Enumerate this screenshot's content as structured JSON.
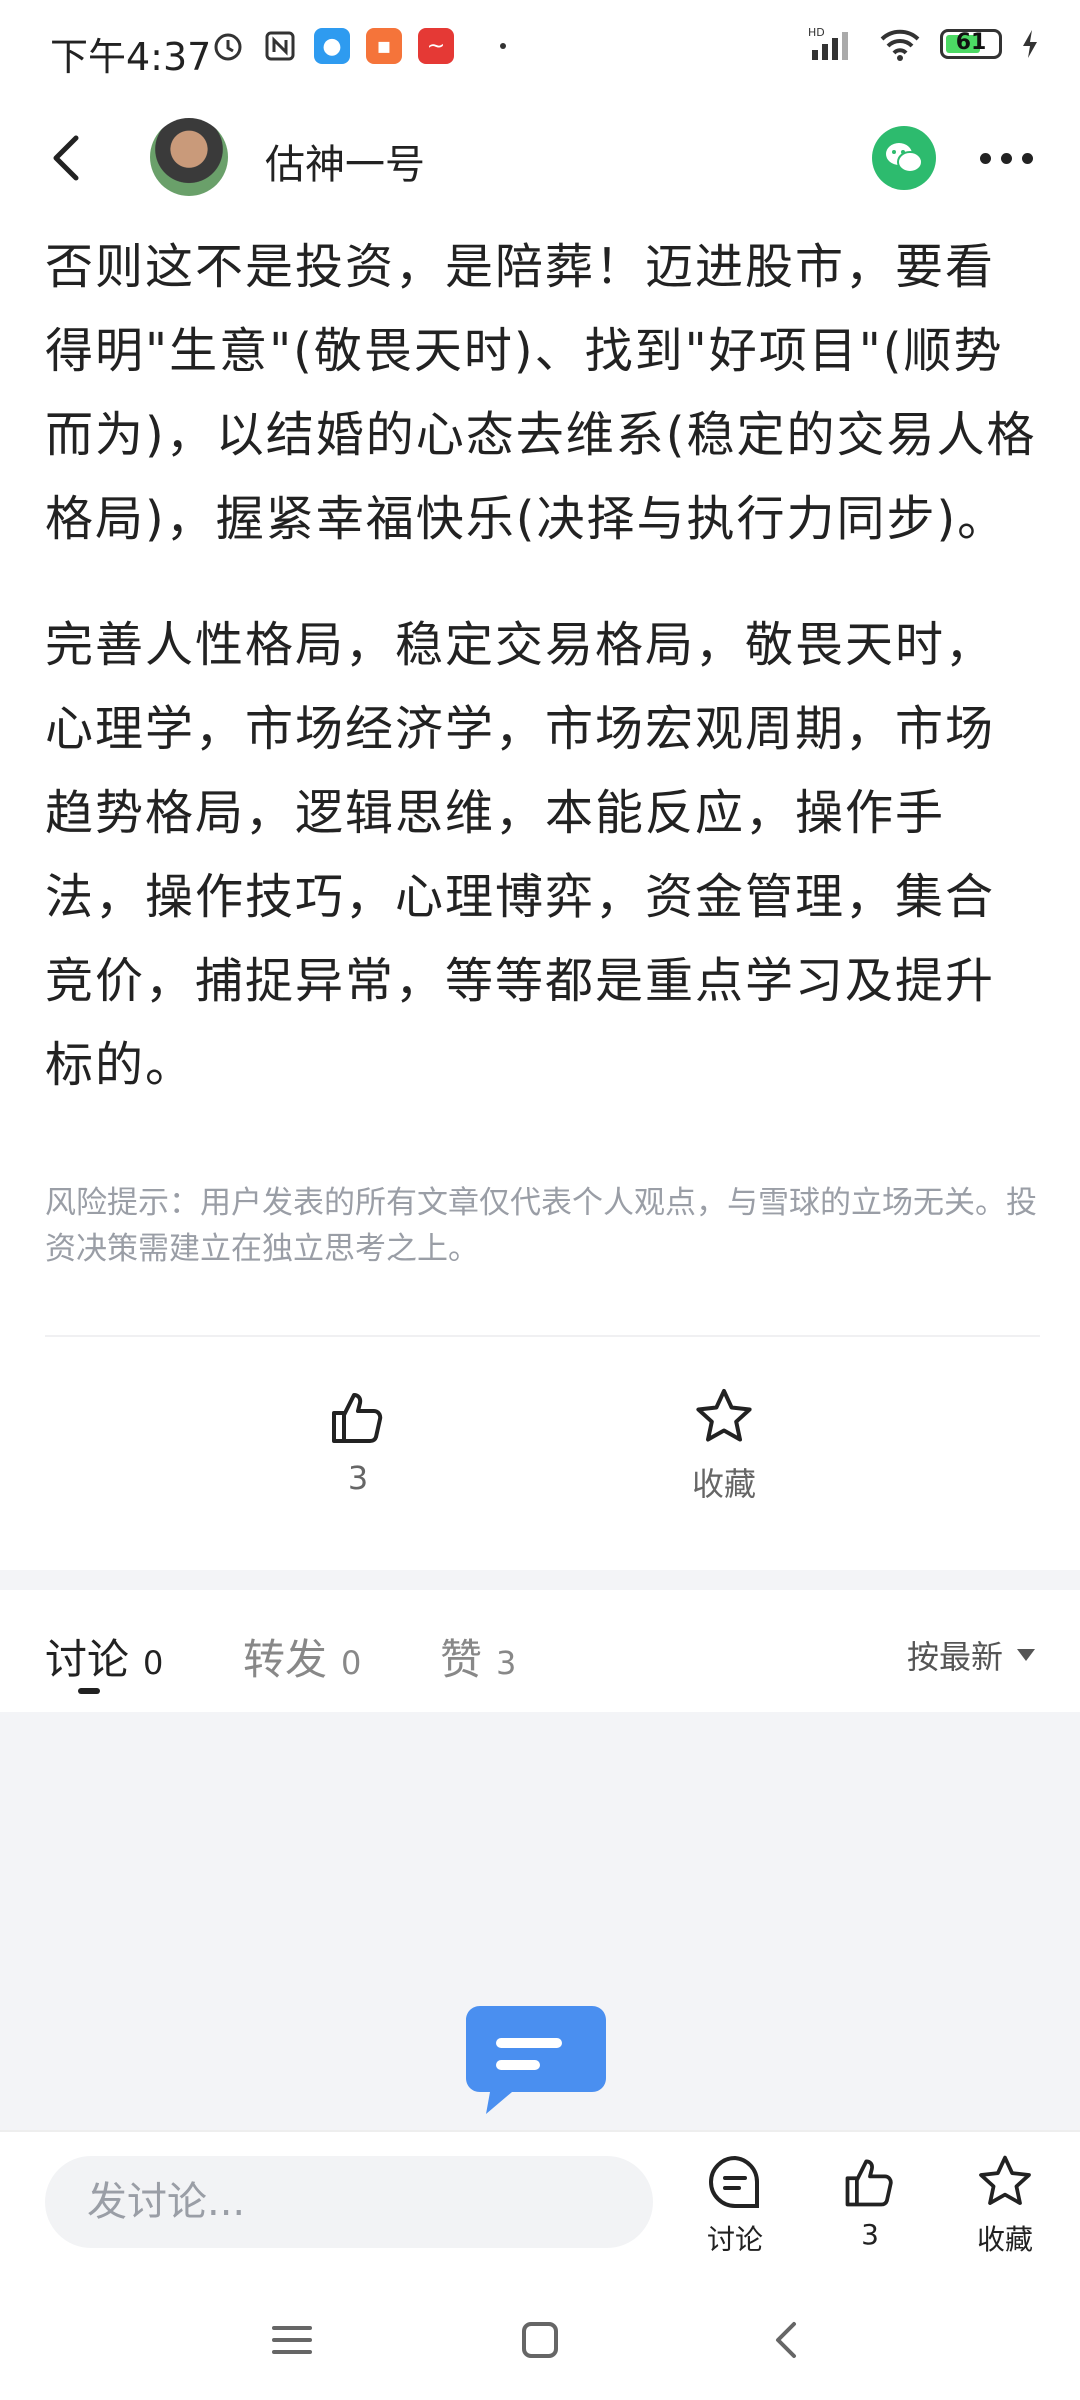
{
  "status_bar": {
    "time": "下午4:37",
    "network": "HD",
    "battery": "61"
  },
  "header": {
    "author_name": "估神一号"
  },
  "article": {
    "paragraphs": [
      "否则这不是投资，是陪葬！迈进股市，要看得明\"生意\"(敬畏天时)、找到\"好项目\"(顺势而为)，以结婚的心态去维系(稳定的交易人格格局)，握紧幸福快乐(决择与执行力同步)。",
      "完善人性格局，稳定交易格局，敬畏天时，心理学，市场经济学，市场宏观周期，市场趋势格局，逻辑思维，本能反应，操作手法，操作技巧，心理博弈，资金管理，集合竞价，捕捉异常，等等都是重点学习及提升标的。"
    ],
    "risk_notice": "风险提示：用户发表的所有文章仅代表个人观点，与雪球的立场无关。投资决策需建立在独立思考之上。"
  },
  "actions": {
    "like_count": "3",
    "favorite_label": "收藏"
  },
  "tabs": {
    "items": [
      {
        "label": "讨论",
        "count": "0"
      },
      {
        "label": "转发",
        "count": "0"
      },
      {
        "label": "赞",
        "count": "3"
      }
    ],
    "sort_label": "按最新"
  },
  "bottom_bar": {
    "input_placeholder": "发讨论...",
    "discuss_label": "讨论",
    "like_count": "3",
    "favorite_label": "收藏"
  },
  "colors": {
    "accent_green": "#2dbb6e",
    "bubble_blue": "#4a8ff0"
  }
}
